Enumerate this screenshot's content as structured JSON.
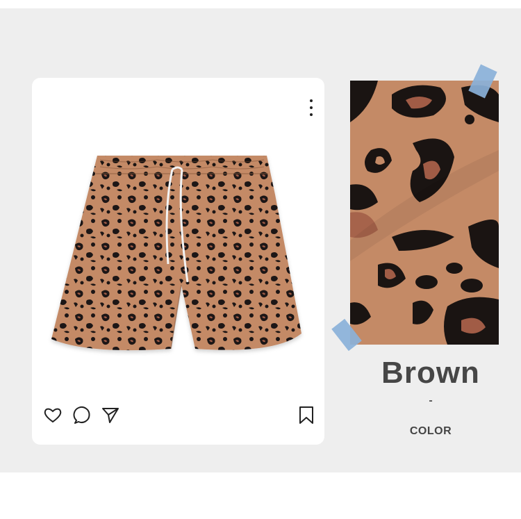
{
  "post": {
    "icons": [
      "more-vertical-icon",
      "heart-icon",
      "comment-icon",
      "share-icon",
      "bookmark-icon"
    ]
  },
  "product": {
    "image": "leopard-print-shorts",
    "colors": {
      "base": "#c48a66",
      "spot": "#1a1412",
      "accent": "#a15c46",
      "drawstring": "#f3f3f3"
    }
  },
  "swatch": {
    "image": "leopard-fabric-closeup",
    "tape_color": "#8ab1d9"
  },
  "color_info": {
    "name": "Brown",
    "separator": "-",
    "label": "COLOR"
  }
}
